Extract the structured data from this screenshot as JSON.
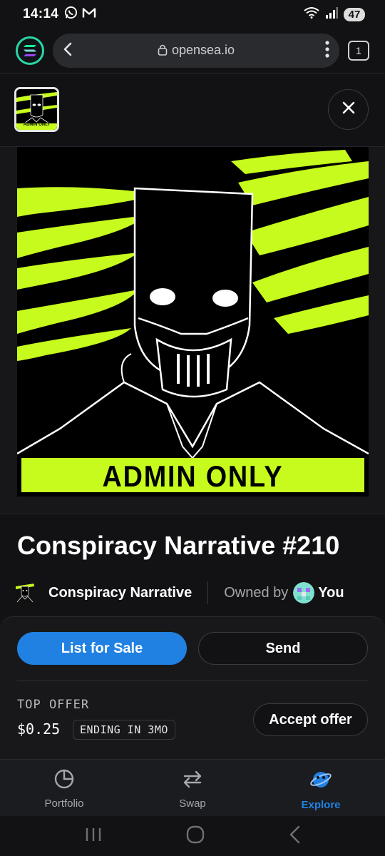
{
  "status_bar": {
    "time": "14:14",
    "battery": "47",
    "icons": [
      "whatsapp-icon",
      "gmail-icon",
      "wifi-icon",
      "signal-icon"
    ]
  },
  "browser": {
    "url": "opensea.io",
    "tab_count": "1"
  },
  "artwork": {
    "banner_text": "ADMIN ONLY",
    "thumbnail_text": "ADMIN ONLY",
    "accent_color": "#c6fb1d"
  },
  "item": {
    "title": "Conspiracy Narrative #210",
    "collection": "Conspiracy Narrative",
    "owned_label": "Owned by",
    "owner": "You"
  },
  "actions": {
    "list_label": "List for Sale",
    "send_label": "Send",
    "top_offer_label": "TOP OFFER",
    "top_offer_price": "$0.25",
    "offer_ending": "ENDING IN 3MO",
    "accept_label": "Accept offer"
  },
  "nav": {
    "items": [
      {
        "label": "Portfolio",
        "icon": "pie-chart-icon"
      },
      {
        "label": "Swap",
        "icon": "swap-icon"
      },
      {
        "label": "Explore",
        "icon": "planet-icon"
      }
    ],
    "active": "Explore"
  },
  "colors": {
    "primary": "#2081e2",
    "background": "#121214",
    "lime": "#c6fb1d"
  }
}
